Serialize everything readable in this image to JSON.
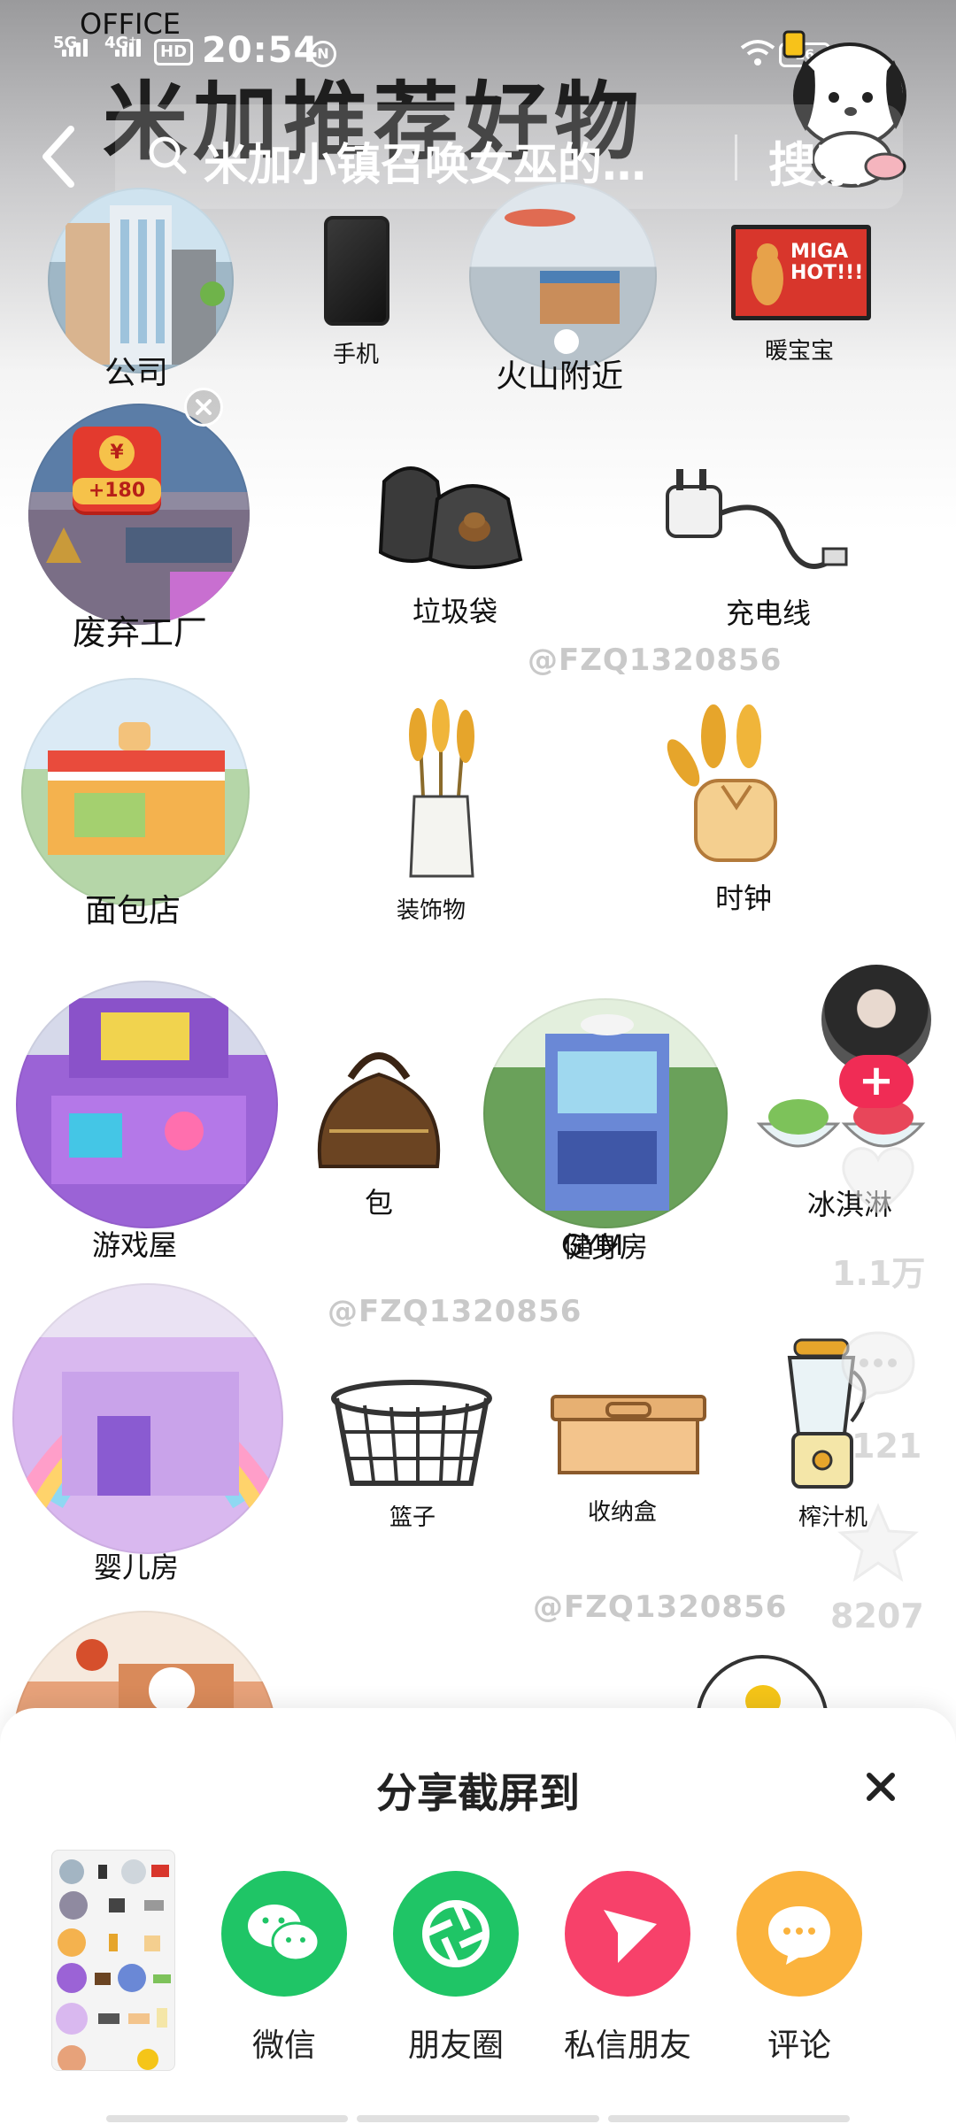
{
  "status_bar": {
    "network_1": "5G",
    "network_2": "4G⁺",
    "hd_badge": "HD",
    "time": "20:54",
    "battery": "16"
  },
  "header": {
    "overlay_title": "米加推荐好物",
    "search_query": "米加小镇召唤女巫的…",
    "search_button": "搜索"
  },
  "items": {
    "company": "公司",
    "phone": "手机",
    "volcano": "火山附近",
    "warmer": "暖宝宝",
    "warmer_pack_text": "MIGA HOT!!!",
    "factory": "废弃工厂",
    "trash_bag": "垃圾袋",
    "charger": "充电线",
    "bakery": "面包店",
    "decoration": "装饰物",
    "clock": "时钟",
    "game_house": "游戏屋",
    "bag": "包",
    "gym": "健身房",
    "ice_cream": "冰淇淋",
    "nursery": "婴儿房",
    "basket": "篮子",
    "storage_box": "收纳盒",
    "juicer": "榨汁机",
    "company_sign": "OFFICE",
    "gym_sign": "GYM"
  },
  "reward_badge": "+180",
  "watermark": "@FZQ1320856",
  "rail": {
    "likes": "1.1万",
    "comments": "121",
    "favorites": "8207"
  },
  "share_sheet": {
    "title": "分享截屏到",
    "options": [
      {
        "label": "微信",
        "color": "#1fc566"
      },
      {
        "label": "朋友圈",
        "color": "#1fc566"
      },
      {
        "label": "私信朋友",
        "color": "#f7416a"
      },
      {
        "label": "评论",
        "color": "#fbb33d"
      }
    ]
  }
}
